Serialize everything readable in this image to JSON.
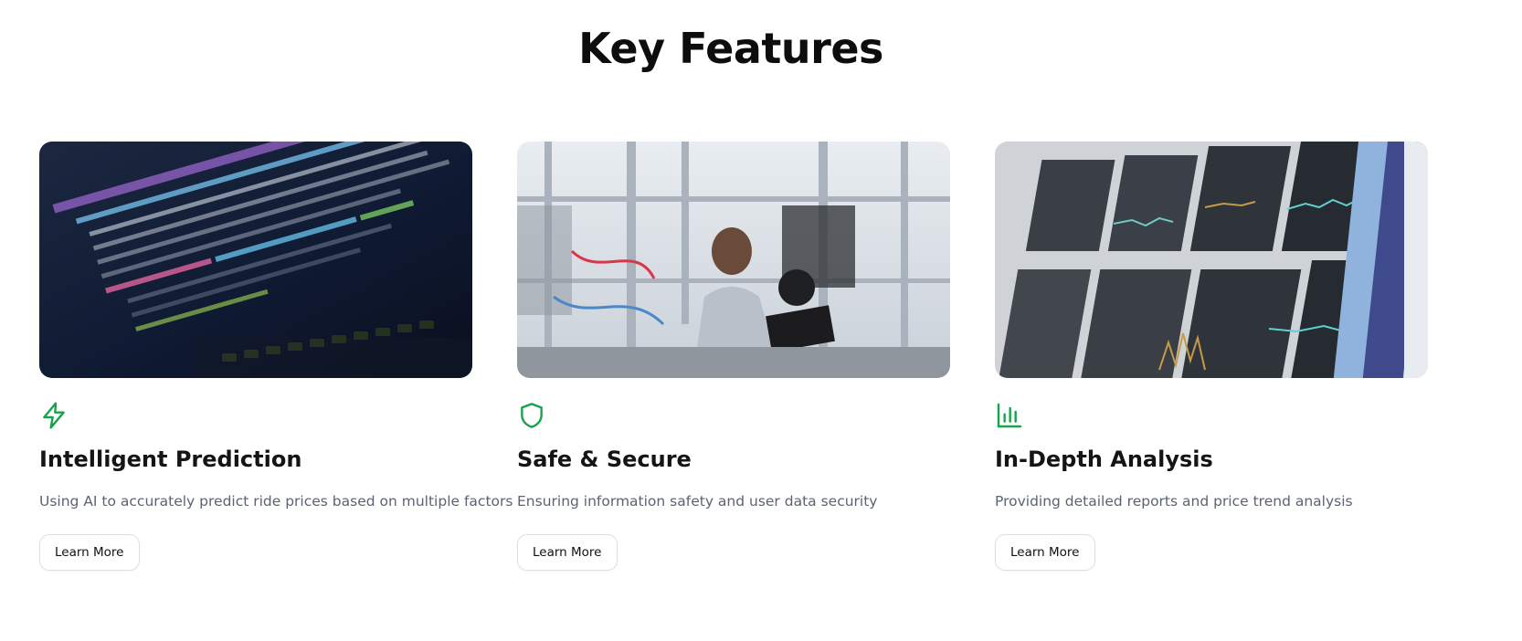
{
  "section": {
    "title": "Key Features"
  },
  "accent_color": "#16a34a",
  "features": [
    {
      "icon": "lightning-bolt-icon",
      "image": "laptop-with-code-photo",
      "title": "Intelligent Prediction",
      "description": "Using AI to accurately predict ride prices based on multiple factors",
      "button_label": "Learn More"
    },
    {
      "icon": "shield-icon",
      "image": "engineer-in-lab-photo",
      "title": "Safe & Secure",
      "description": "Ensuring information safety and user data security",
      "button_label": "Learn More"
    },
    {
      "icon": "bar-chart-icon",
      "image": "analytics-dashboard-photo",
      "title": "In-Depth Analysis",
      "description": "Providing detailed reports and price trend analysis",
      "button_label": "Learn More"
    }
  ]
}
